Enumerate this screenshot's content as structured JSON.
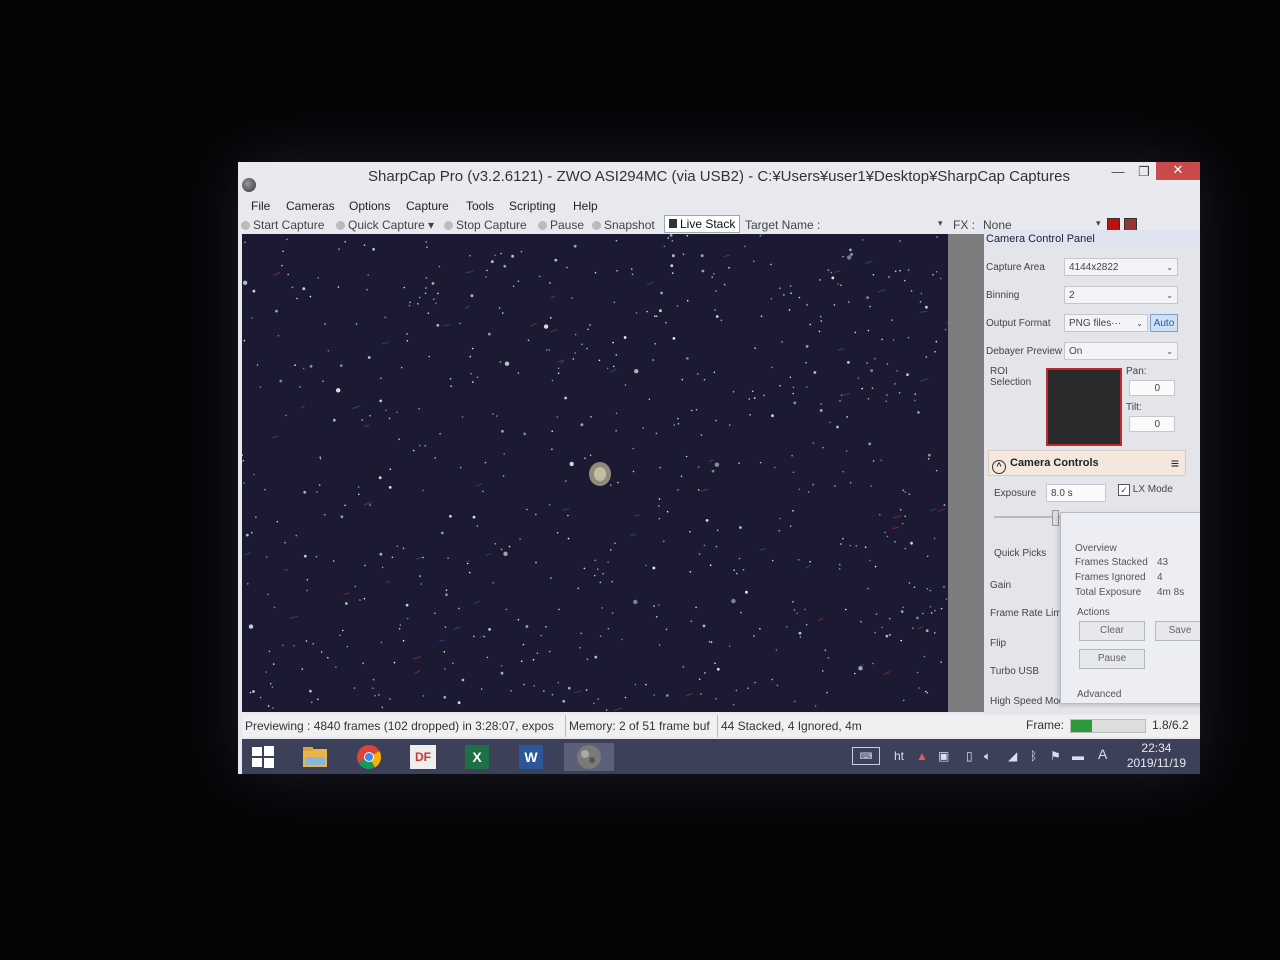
{
  "window": {
    "title": "SharpCap Pro (v3.2.6121) - ZWO ASI294MC (via USB2) - C:¥Users¥user1¥Desktop¥SharpCap Captures",
    "min": "—",
    "max": "❐",
    "close": "✕"
  },
  "menu": [
    "File",
    "Cameras",
    "Options",
    "Capture",
    "Tools",
    "Scripting",
    "Help"
  ],
  "toolbar": {
    "start_capture": "Start Capture",
    "quick_capture": "Quick Capture",
    "stop_capture": "Stop Capture",
    "pause": "Pause",
    "snapshot": "Snapshot",
    "live_stack": "Live Stack",
    "target_name_label": "Target Name :",
    "fx_label": "FX :",
    "fx_value": "None"
  },
  "panel": {
    "header": "Camera Control Panel",
    "capture_area_label": "Capture Area",
    "capture_area_value": "4144x2822",
    "binning_label": "Binning",
    "binning_value": "2",
    "output_format_label": "Output Format",
    "output_format_value": "PNG files···",
    "auto_label": "Auto",
    "debayer_label": "Debayer Preview",
    "debayer_value": "On",
    "roi_label": "ROI Selection",
    "pan_label": "Pan:",
    "pan_value": "0",
    "tilt_label": "Tilt:",
    "tilt_value": "0",
    "camera_controls_label": "Camera Controls",
    "exposure_label": "Exposure",
    "exposure_value": "8.0 s",
    "lx_mode_label": "LX Mode",
    "quick_picks_label": "Quick Picks",
    "gain_label": "Gain",
    "frame_rate_label": "Frame Rate Lim",
    "flip_label": "Flip",
    "turbo_usb_label": "Turbo USB",
    "high_speed_label": "High Speed Mod"
  },
  "live_stack": {
    "overview_label": "Overview",
    "frames_stacked_label": "Frames Stacked",
    "frames_stacked_value": "43",
    "frames_ignored_label": "Frames Ignored",
    "frames_ignored_value": "4",
    "total_exposure_label": "Total Exposure",
    "total_exposure_value": "4m 8s",
    "actions_label": "Actions",
    "clear_label": "Clear",
    "save_label": "Save",
    "pause_label": "Pause",
    "advanced_label": "Advanced"
  },
  "status": {
    "previewing": "Previewing : 4840 frames (102 dropped) in 3:28:07, expos",
    "memory": "Memory: 2 of 51 frame buf",
    "stacked": "44 Stacked, 4 Ignored, 4m",
    "frame_label": "Frame:",
    "frame_value": "1.8/6.2",
    "frame_progress": 0.29
  },
  "taskbar": {
    "apps": [
      "windows-start",
      "file-explorer",
      "chrome",
      "df-app",
      "excel",
      "word",
      "sharpcap"
    ],
    "ime": "A",
    "time": "22:34",
    "date": "2019/11/19"
  }
}
